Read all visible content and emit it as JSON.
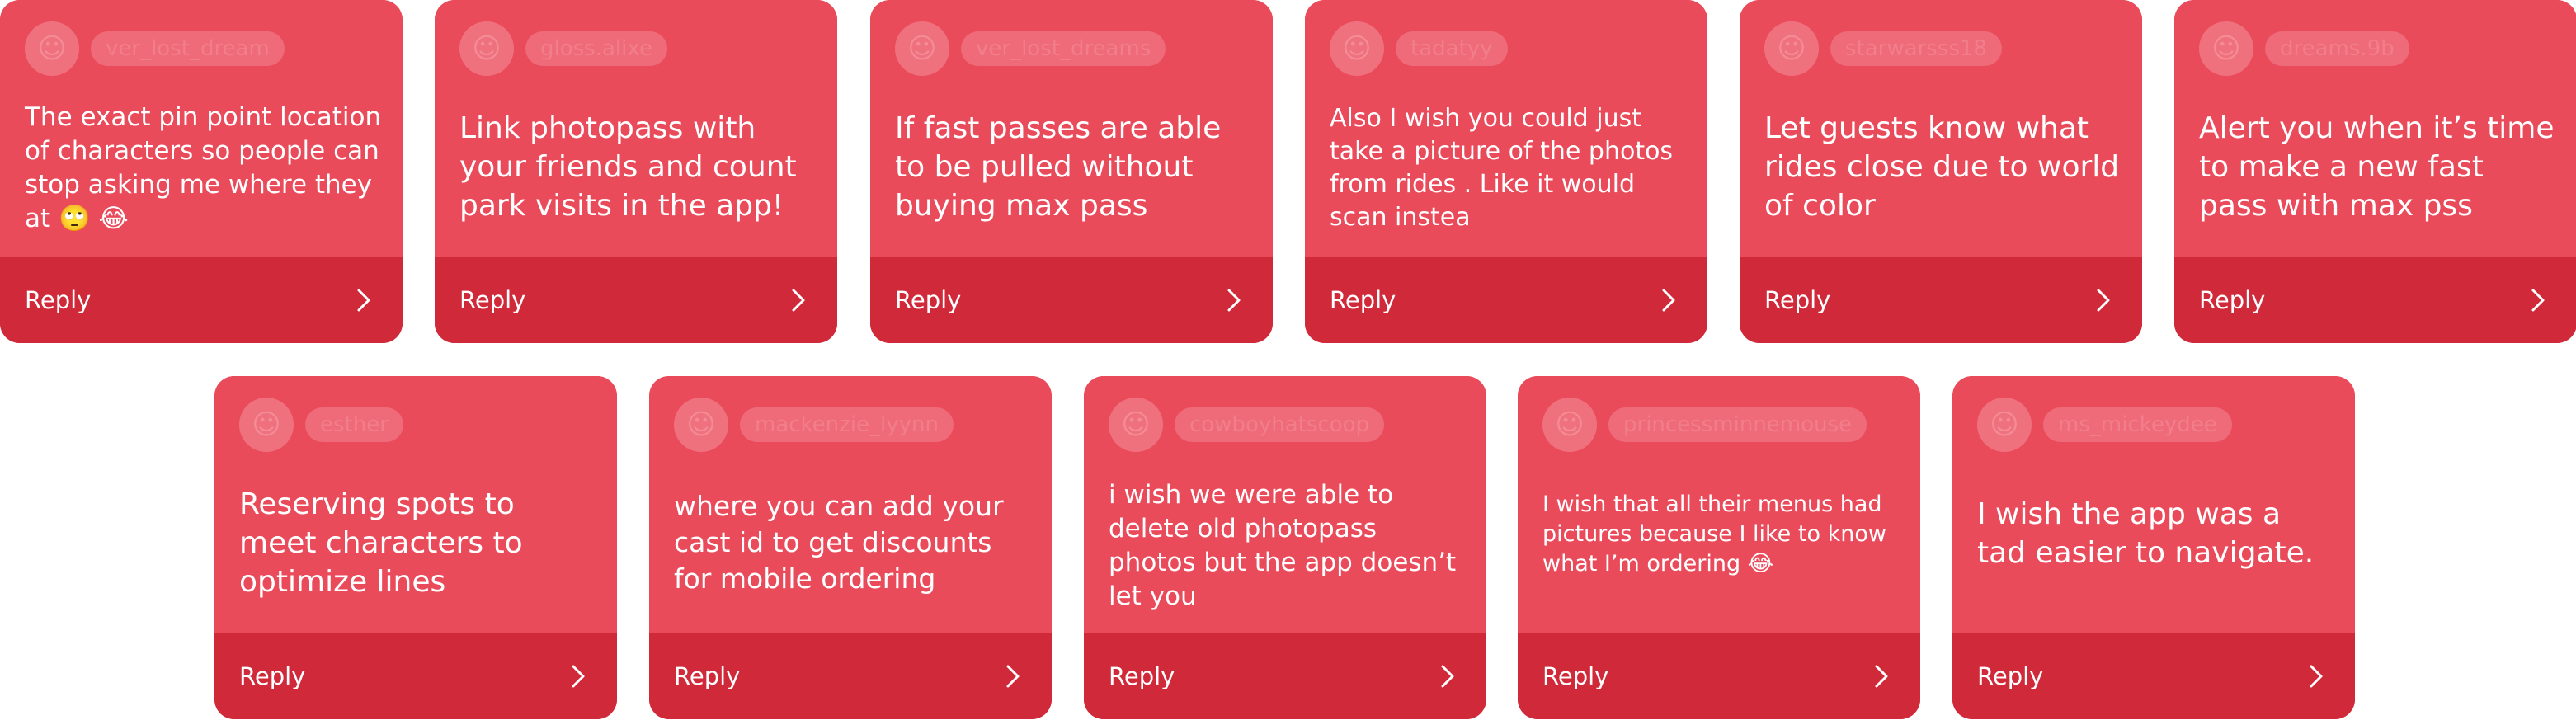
{
  "reply_label": "Reply",
  "colors": {
    "card_bg": "#ea4b5b",
    "reply_bar_bg": "#d02a3a",
    "text": "#ffffff"
  },
  "cards": [
    {
      "username": "ver_lost_dream",
      "message": "The exact pin point location of characters so people can stop asking me where they at 🙄 😂"
    },
    {
      "username": "gloss.alixe",
      "message": "Link photopass with your friends and count park visits in the app!"
    },
    {
      "username": "ver_lost_dreams",
      "message": "If fast passes are able to be pulled without buying max pass"
    },
    {
      "username": "tadatyy",
      "message": "Also I wish you could just take a picture of the photos from rides . Like it would scan instea"
    },
    {
      "username": "starwarsss18",
      "message": "Let guests know what rides close due to world of color"
    },
    {
      "username": "dreams.9b",
      "message": "Alert you when it’s time to make a new fast pass with max pss"
    },
    {
      "username": "esther",
      "message": "Reserving spots to meet characters to optimize lines"
    },
    {
      "username": "mackenzie_lyynn",
      "message": "where you can add your cast id to get discounts for mobile ordering"
    },
    {
      "username": "cowboyhatscoop",
      "message": "i wish we were able to delete old photopass photos but the app doesn’t let you"
    },
    {
      "username": "princessminnemouse",
      "message": "I wish that all their menus had pictures because I like to know what I’m ordering 😂"
    },
    {
      "username": "ms_mickeydee",
      "message": "I wish the app was a tad easier to navigate."
    }
  ]
}
